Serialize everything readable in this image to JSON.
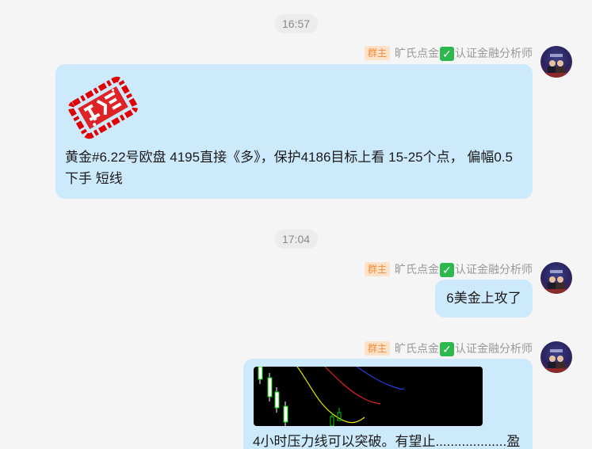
{
  "timestamps": [
    "16:57",
    "17:04"
  ],
  "sender": {
    "badge": "群主",
    "name_prefix": "旷氏点金",
    "name_suffix": "认证金融分析师",
    "verified_icon": "green-check-box-icon"
  },
  "messages": [
    {
      "type": "image_text",
      "image": "red-stamp-image",
      "text": "黄金#6.22号欧盘 4195直接《多》，保护4186目标上看  15-25个点，  偏幅0.5下手       短线"
    },
    {
      "type": "text",
      "text": "6美金上攻了"
    },
    {
      "type": "image_text",
      "image": "candlestick-chart-image",
      "text": "4小时压力线可以突破。有望止...................盈"
    }
  ],
  "colors": {
    "background": "#f5f5f5",
    "bubble": "#cde9fc",
    "badge_bg": "#fde1c8",
    "badge_text": "#f08c3c",
    "verified": "#2db84d"
  }
}
